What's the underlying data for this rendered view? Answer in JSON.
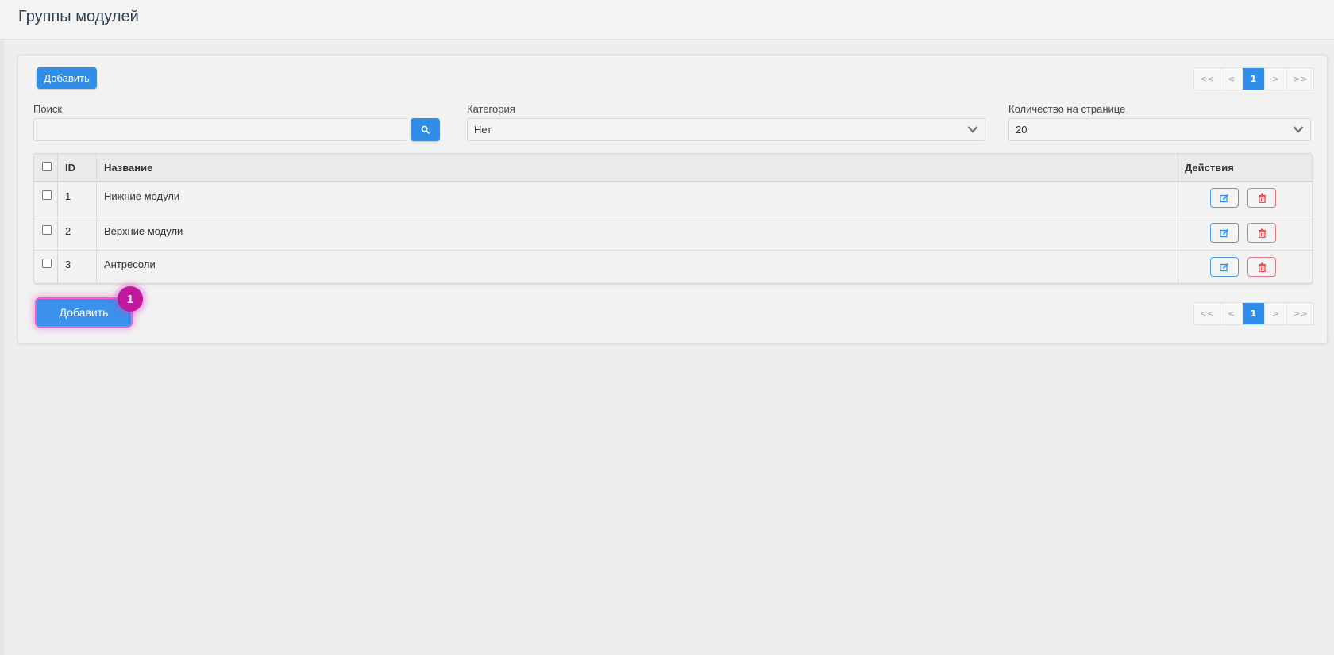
{
  "header": {
    "title": "Группы модулей"
  },
  "toolbar": {
    "add_label": "Добавить"
  },
  "pagination": {
    "first": "<<",
    "prev": "<",
    "current": "1",
    "next": ">",
    "last": ">>"
  },
  "filters": {
    "search_label": "Поиск",
    "search_value": "",
    "search_icon": "search-icon",
    "category_label": "Категория",
    "category_value": "Нет",
    "per_page_label": "Количество на странице",
    "per_page_value": "20"
  },
  "table": {
    "columns": {
      "id": "ID",
      "name": "Название",
      "actions": "Действия"
    },
    "rows": [
      {
        "id": "1",
        "name": "Нижние модули"
      },
      {
        "id": "2",
        "name": "Верхние модули"
      },
      {
        "id": "3",
        "name": "Антресоли"
      }
    ],
    "edit_icon": "edit-icon",
    "delete_icon": "trash-icon"
  },
  "bottom": {
    "add_label": "Добавить",
    "step_badge": "1"
  },
  "colors": {
    "primary": "#2f8fe8",
    "danger": "#d9534f",
    "badge": "#c0199d"
  }
}
